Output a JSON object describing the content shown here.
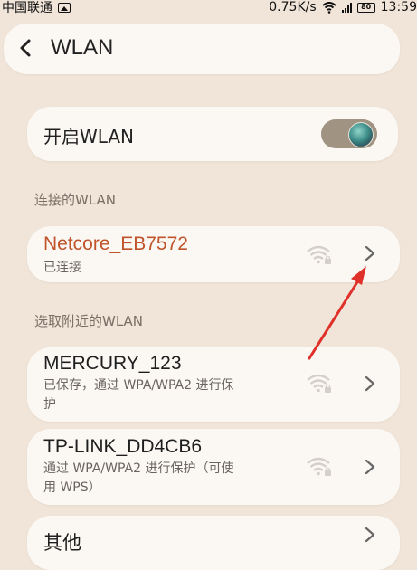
{
  "status_bar": {
    "carrier": "中国联通",
    "speed": "0.75K/s",
    "battery": "80",
    "time": "13:59"
  },
  "header": {
    "title": "WLAN"
  },
  "toggle": {
    "label": "开启WLAN",
    "enabled": true
  },
  "connected_section": {
    "heading": "连接的WLAN",
    "network": {
      "name": "Netcore_EB7572",
      "status": "已连接",
      "name_color": "#c0532a"
    }
  },
  "nearby_section": {
    "heading": "选取附近的WLAN",
    "networks": [
      {
        "name": "MERCURY_123",
        "detail_line1": "已保存，通过 WPA/WPA2 进行保",
        "detail_line2": "护"
      },
      {
        "name": "TP-LINK_DD4CB6",
        "detail_line1": "通过 WPA/WPA2 进行保护（可使",
        "detail_line2": "用 WPS）"
      },
      {
        "name": "其他"
      }
    ]
  },
  "annotation": {
    "color": "#e0302a"
  }
}
